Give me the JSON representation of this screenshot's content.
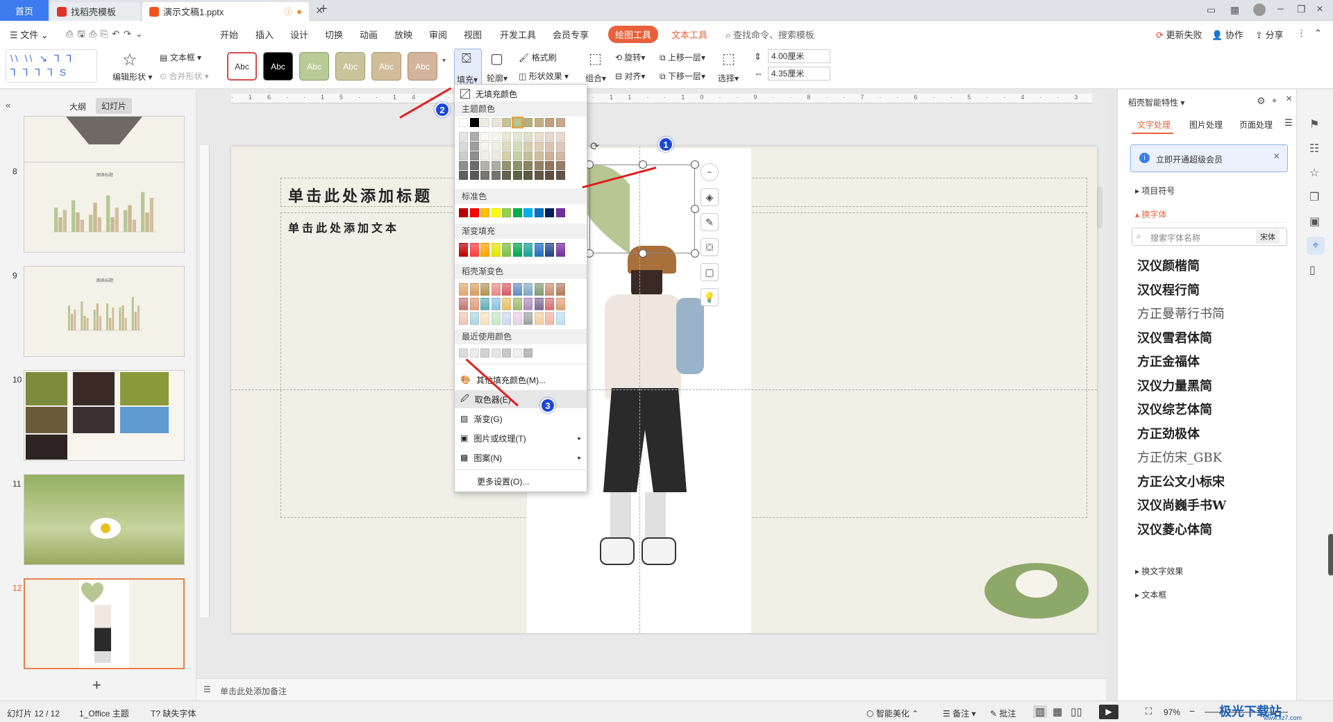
{
  "tabs": {
    "home": "首页",
    "template": "找稻壳模板",
    "doc": "演示文稿1.pptx"
  },
  "menu": {
    "file": "文件",
    "items": [
      "开始",
      "插入",
      "设计",
      "切换",
      "动画",
      "放映",
      "审阅",
      "视图",
      "开发工具",
      "会员专享"
    ],
    "drawing_tools": "绘图工具",
    "text_tools": "文本工具",
    "search": "查找命令、搜索模板",
    "update": "更新失败",
    "collab": "协作",
    "share": "分享"
  },
  "ribbon": {
    "edit_shape": "编辑形状",
    "textbox": "文本框",
    "merge_shape": "合并形状",
    "style_label": "Abc",
    "fill": "填充",
    "outline": "轮廓",
    "format_brush": "格式刷",
    "shape_effect": "形状效果",
    "group": "组合",
    "rotate": "旋转",
    "align": "对齐",
    "bring_forward": "上移一层",
    "send_backward": "下移一层",
    "select": "选择",
    "height": "4.00厘米",
    "width": "4.35厘米",
    "style_colors": [
      "#ffffff",
      "#000000",
      "#b9cc97",
      "#c9c49b",
      "#d2bd9b",
      "#d4b49a"
    ]
  },
  "leftpanel": {
    "outline_tab": "大纲",
    "slides_tab": "幻灯片",
    "slide_numbers": [
      "8",
      "9",
      "10",
      "11",
      "12"
    ],
    "add": "+"
  },
  "chart_data": [
    {
      "type": "bar",
      "categories": [
        "1",
        "2",
        "3",
        "4",
        "5",
        "6"
      ],
      "series": [
        {
          "values": [
            50,
            65,
            35,
            75,
            45,
            82
          ]
        },
        {
          "values": [
            30,
            40,
            60,
            30,
            55,
            40
          ]
        },
        {
          "values": [
            45,
            25,
            30,
            50,
            25,
            70
          ]
        }
      ],
      "title": "图表标题",
      "ylim": [
        0,
        100
      ]
    },
    {
      "type": "bar",
      "categories": [
        "1",
        "2",
        "3",
        "4",
        "5",
        "6"
      ],
      "series": [
        {
          "values": [
            60,
            70,
            50,
            65,
            55,
            80
          ]
        },
        {
          "values": [
            40,
            35,
            65,
            30,
            60,
            45
          ]
        },
        {
          "values": [
            50,
            30,
            35,
            55,
            30,
            60
          ]
        }
      ],
      "title": "图表标题",
      "ylim": [
        0,
        100
      ]
    }
  ],
  "slide": {
    "title_placeholder": "单击此处添加标题",
    "body_placeholder": "单击此处添加文本"
  },
  "dropdown": {
    "no_fill": "无填充颜色",
    "theme_colors": "主题颜色",
    "standard_colors": "标准色",
    "gradient_fill": "渐变填充",
    "docer_gradient": "稻壳渐变色",
    "recent_colors": "最近使用颜色",
    "more_colors": "其他填充颜色(M)...",
    "eyedropper": "取色器(E)",
    "gradient": "渐变(G)",
    "picture_texture": "图片或纹理(T)",
    "pattern": "图案(N)",
    "more_settings": "更多设置(O)...",
    "theme_top": [
      "#ffffff",
      "#000000",
      "#eeece1",
      "#e8e6da",
      "#c8c397",
      "#b9c592",
      "#b5b17f",
      "#c6ae86",
      "#c59d7f",
      "#c7a78d"
    ],
    "standard": [
      "#c00000",
      "#ff0000",
      "#ffc000",
      "#ffff00",
      "#92d050",
      "#00b050",
      "#00b0f0",
      "#0070c0",
      "#002060",
      "#7030a0"
    ],
    "gradients": [
      "#c00000",
      "#ff3b3b",
      "#ffa500",
      "#e6e600",
      "#7cc04a",
      "#00a651",
      "#17a19b",
      "#1f6fbf",
      "#1f3f8f",
      "#7030a0"
    ]
  },
  "rightpanel": {
    "title": "稻壳智能特性",
    "tabs": [
      "文字处理",
      "图片处理",
      "页面处理"
    ],
    "vip": "立即开通超级会员",
    "bullets": "项目符号",
    "change_font": "换字体",
    "font_search": "搜索字体名称",
    "current_font": "宋体",
    "fonts": [
      "汉仪颜楷简",
      "汉仪程行简",
      "方正曼蒂行书简",
      "汉仪雪君体简",
      "方正金福体",
      "汉仪力量黑简",
      "汉仪综艺体简",
      "方正劲极体",
      "方正仿宋_GBK",
      "方正公文小标宋",
      "汉仪尚巍手书W",
      "汉仪菱心体简"
    ],
    "text_effect": "换文字效果",
    "textbox": "文本框"
  },
  "notes": {
    "placeholder": "单击此处添加备注"
  },
  "status": {
    "slide_info": "幻灯片 12 / 12",
    "theme": "1_Office 主题",
    "missing_font": "缺失字体",
    "smart_beautify": "智能美化",
    "notes": "备注",
    "comments": "批注",
    "zoom": "97%"
  },
  "badges": [
    "1",
    "2",
    "3"
  ],
  "watermark": "极光下载站",
  "watermark_url": "www.xz7.com"
}
